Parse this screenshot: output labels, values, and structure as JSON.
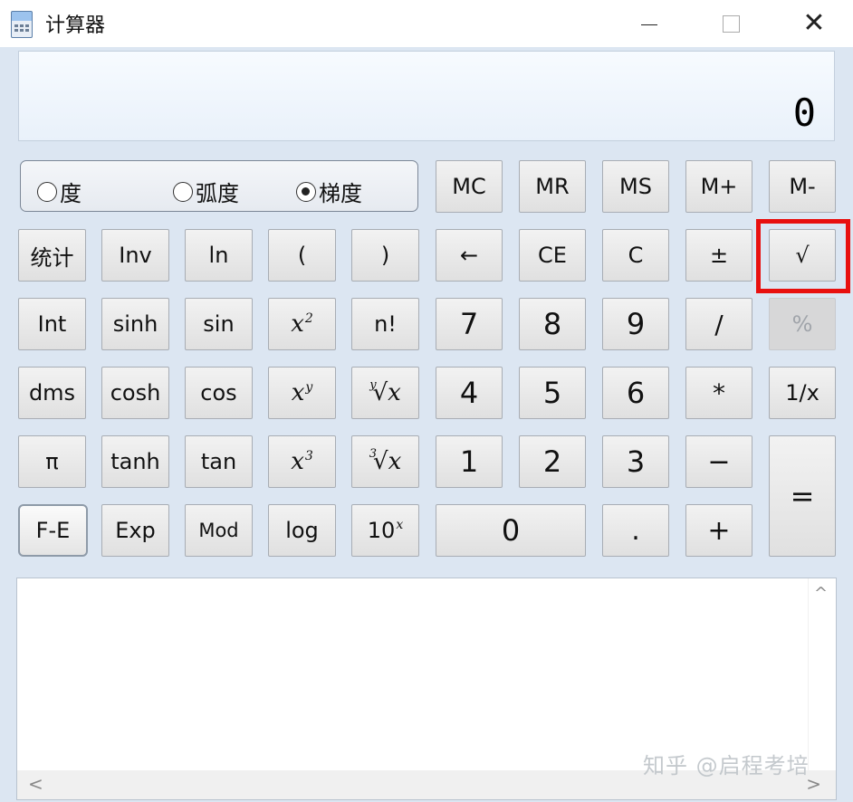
{
  "window": {
    "title": "计算器",
    "app_icon": "calculator-icon",
    "controls": {
      "minimize": "minimize-icon",
      "maximize": "maximize-icon",
      "close": "✕"
    }
  },
  "display": {
    "value": "0"
  },
  "angle_mode": {
    "options": [
      "度",
      "弧度",
      "梯度"
    ],
    "selected": "梯度"
  },
  "buttons": {
    "mc": "MC",
    "mr": "MR",
    "ms": "MS",
    "mplus": "M+",
    "mminus": "M-",
    "stats": "统计",
    "inv": "Inv",
    "ln": "ln",
    "lparen": "(",
    "rparen": ")",
    "backspace": "←",
    "ce": "CE",
    "c": "C",
    "plusminus": "±",
    "sqrt": "√",
    "int": "Int",
    "sinh": "sinh",
    "sin": "sin",
    "x2": "x",
    "x2_sup": "2",
    "fact": "n!",
    "seven": "7",
    "eight": "8",
    "nine": "9",
    "divide": "/",
    "percent": "%",
    "dms": "dms",
    "cosh": "cosh",
    "cos": "cos",
    "xy": "x",
    "xy_sup": "y",
    "yroot_pre": "y",
    "yroot": "√x",
    "four": "4",
    "five": "5",
    "six": "6",
    "multiply": "*",
    "reciprocal": "1/x",
    "pi": "π",
    "tanh": "tanh",
    "tan": "tan",
    "x3": "x",
    "x3_sup": "3",
    "cbrt_pre": "3",
    "cbrt": "√x",
    "one": "1",
    "two": "2",
    "three": "3",
    "minus": "−",
    "equals": "=",
    "fe": "F-E",
    "exp": "Exp",
    "mod": "Mod",
    "log": "log",
    "tenx": "10",
    "tenx_sup": "x",
    "zero": "0",
    "decimal": ".",
    "plus": "+"
  },
  "highlight": {
    "target": "sqrt",
    "color": "#e8100f"
  },
  "history": {
    "scroll_up": "^",
    "scroll_left": "<",
    "scroll_right": ">"
  },
  "watermark": "知乎 @启程考培"
}
